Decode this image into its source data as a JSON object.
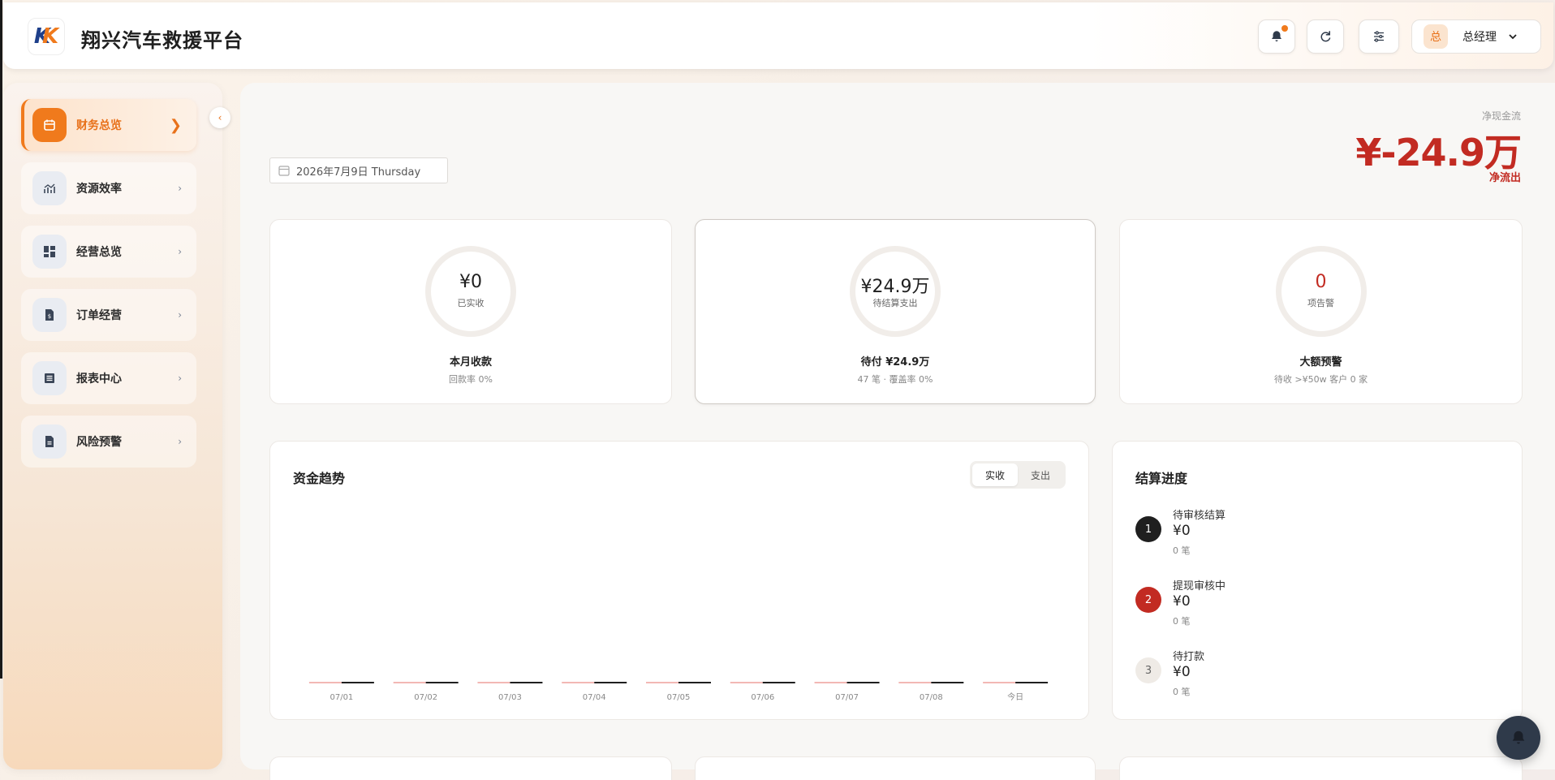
{
  "header": {
    "logo_text": "KS",
    "title": "翔兴汽车救援平台",
    "user": {
      "avatar_char": "总",
      "name": "总经理"
    }
  },
  "sidebar": {
    "items": [
      {
        "label": "财务总览",
        "icon": "calendar-icon",
        "active": true
      },
      {
        "label": "资源效率",
        "icon": "chart-trend-icon",
        "active": false
      },
      {
        "label": "经营总览",
        "icon": "dashboard-icon",
        "active": false
      },
      {
        "label": "订单经营",
        "icon": "invoice-icon",
        "active": false
      },
      {
        "label": "报表中心",
        "icon": "list-doc-icon",
        "active": false
      },
      {
        "label": "风险预警",
        "icon": "document-icon",
        "active": false
      }
    ]
  },
  "main": {
    "date": "2026年7月9日 Thursday",
    "net_cash": {
      "label": "净现金流",
      "value": "¥-24.9万",
      "status": "净流出"
    },
    "kpis": [
      {
        "value": "¥0",
        "sub": "已实收",
        "title": "本月收款",
        "desc": "回款率 0%"
      },
      {
        "value": "¥24.9万",
        "sub": "待结算支出",
        "title": "待付 ¥24.9万",
        "desc": "47 笔 · 覆盖率 0%"
      },
      {
        "value": "0",
        "sub": "项告警",
        "title": "大额预警",
        "desc": "待收 >¥50w 客户 0 家"
      }
    ],
    "trend": {
      "title": "资金趋势",
      "toggle": [
        "实收",
        "支出"
      ],
      "active_toggle": "实收"
    },
    "progress": {
      "title": "结算进度",
      "steps": [
        {
          "num": "1",
          "label": "待审核结算",
          "amount": "¥0",
          "count": "0 笔",
          "color": "#1f1f1f"
        },
        {
          "num": "2",
          "label": "提现审核中",
          "amount": "¥0",
          "count": "0 笔",
          "color": "#c22b22"
        },
        {
          "num": "3",
          "label": "待打款",
          "amount": "¥0",
          "count": "0 笔",
          "color": "#efebe6"
        }
      ]
    }
  },
  "chart_data": {
    "type": "bar",
    "categories": [
      "07/01",
      "07/02",
      "07/03",
      "07/04",
      "07/05",
      "07/06",
      "07/07",
      "07/08",
      "今日"
    ],
    "series": [
      {
        "name": "实收",
        "values": [
          0,
          0,
          0,
          0,
          0,
          0,
          0,
          0,
          0
        ],
        "color": "#f2b8b4"
      },
      {
        "name": "支出",
        "values": [
          0,
          0,
          0,
          0,
          0,
          0,
          0,
          0,
          0
        ],
        "color": "#1f1f1f"
      }
    ],
    "title": "资金趋势",
    "xlabel": "",
    "ylabel": "",
    "grid": false
  }
}
